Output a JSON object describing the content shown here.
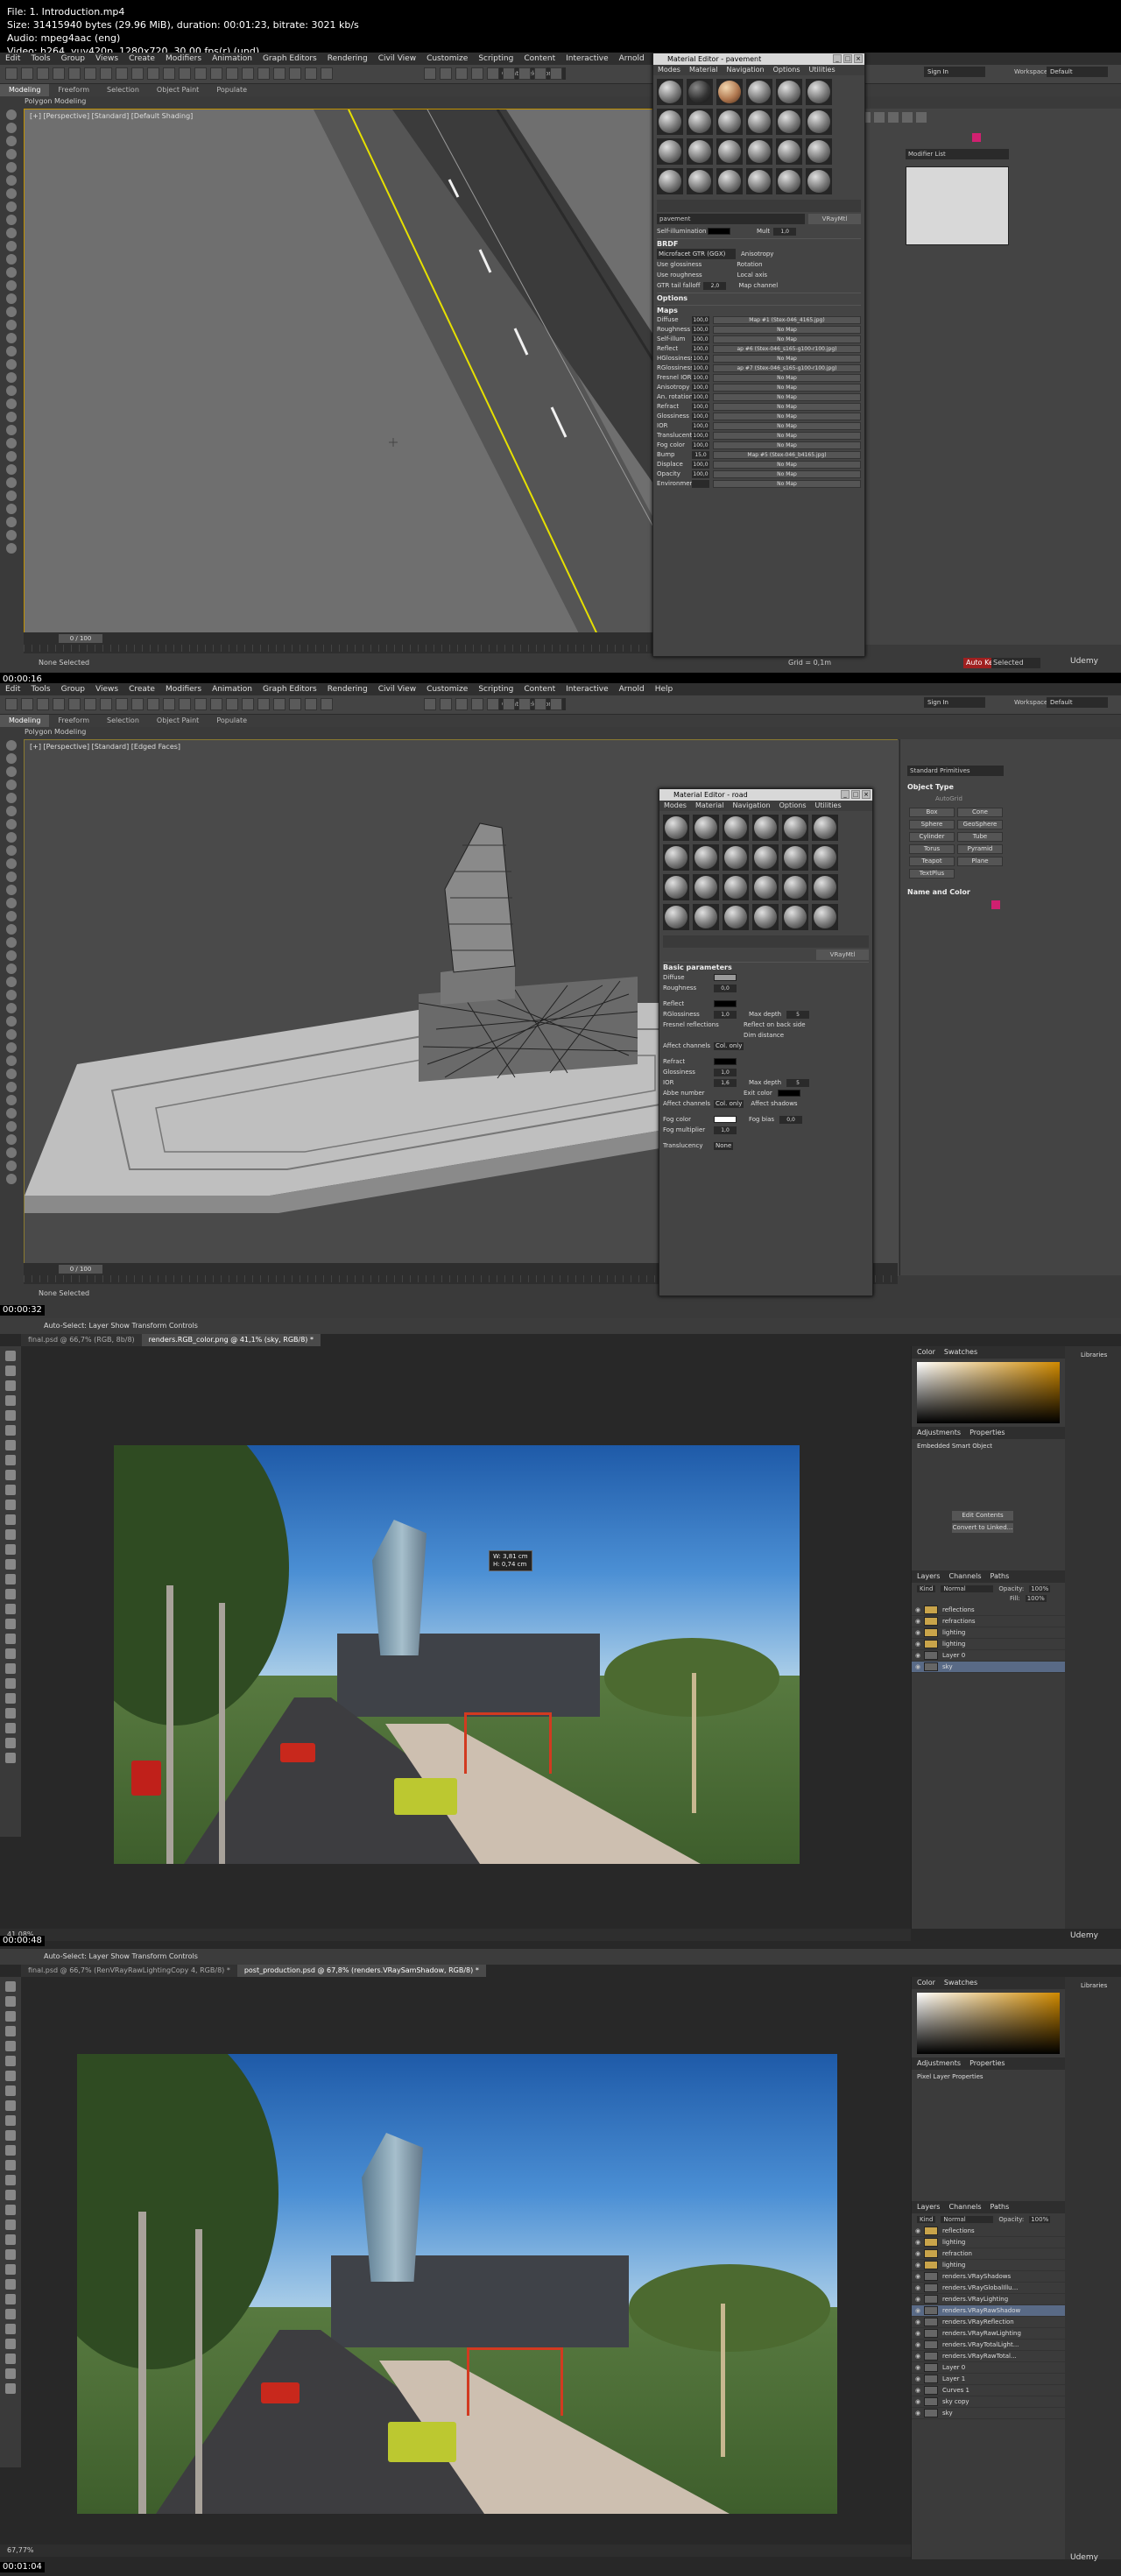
{
  "file_info": {
    "line1": "File: 1. Introduction.mp4",
    "line2": "Size: 31415940 bytes (29.96 MiB), duration: 00:01:23, bitrate: 3021 kb/s",
    "line3": "Audio: mpeg4aac (eng)",
    "line4": "Video: h264, yuv420p, 1280x720, 30.00 fps(r) (und)"
  },
  "max_menu": [
    "Edit",
    "Tools",
    "Group",
    "Views",
    "Create",
    "Modifiers",
    "Animation",
    "Graph Editors",
    "Rendering",
    "Civil View",
    "Customize",
    "Scripting",
    "Content",
    "Interactive",
    "Arnold",
    "Help"
  ],
  "max_ribbon": [
    "Modeling",
    "Freeform",
    "Selection",
    "Object Paint",
    "Populate"
  ],
  "max_signin": "Sign In",
  "max_workspaces_label": "Workspaces:",
  "max_workspaces_value": "Default",
  "max_selection_set": "Create Selection Se",
  "polygon_modeling": "Polygon Modeling",
  "frame1": {
    "timestamp": "00:00:16",
    "vp_label": "[+] [Perspective] [Standard] [Default Shading]",
    "frame_counter": "0 / 100",
    "status_left": "None Selected",
    "grid": "Grid = 0,1m",
    "autokey": "Auto Key",
    "set_key": "Selected",
    "modifier_list": "Modifier List"
  },
  "frame2": {
    "timestamp": "00:00:32",
    "vp_label": "[+] [Perspective] [Standard] [Edged Faces]",
    "frame_counter": "0 / 100",
    "status_left": "None Selected",
    "std_primitives": "Standard Primitives",
    "object_type": "Object Type",
    "autogrid": "AutoGrid",
    "objects": [
      "Box",
      "Cone",
      "Sphere",
      "GeoSphere",
      "Cylinder",
      "Tube",
      "Torus",
      "Pyramid",
      "Teapot",
      "Plane",
      "TextPlus"
    ],
    "name_and_color": "Name and Color"
  },
  "mat1": {
    "title": "Material Editor - pavement",
    "menu": [
      "Modes",
      "Material",
      "Navigation",
      "Options",
      "Utilities"
    ],
    "mat_name": "pavement",
    "mat_type": "VRayMtl",
    "self_illum_label": "Self-illumination",
    "mult_label": "Mult",
    "mult_value": "1,0",
    "brdf_head": "BRDF",
    "brdf_type": "Microfacet GTR (GGX)",
    "use_glossiness": "Use glossiness",
    "use_roughness": "Use roughness",
    "gtr_tail": "GTR tail falloff",
    "gtr_value": "2,0",
    "anisotropy": "Anisotropy",
    "rotation": "Rotation",
    "local_axis": "Local axis",
    "map_channel": "Map channel",
    "options_head": "Options",
    "maps_head": "Maps",
    "maps": [
      {
        "name": "Diffuse",
        "val": "100,0",
        "map": "Map #1 (Stex-046_4165.jpg)"
      },
      {
        "name": "Roughness",
        "val": "100,0",
        "map": "No Map"
      },
      {
        "name": "Self-illum",
        "val": "100,0",
        "map": "No Map"
      },
      {
        "name": "Reflect",
        "val": "100,0",
        "map": "ap #6 (Stex-046_s165-g100-r100.jpg)"
      },
      {
        "name": "HGlossiness",
        "val": "100,0",
        "map": "No Map"
      },
      {
        "name": "RGlossiness",
        "val": "100,0",
        "map": "ap #7 (Stex-046_s165-g100-r100.jpg)"
      },
      {
        "name": "Fresnel IOR",
        "val": "100,0",
        "map": "No Map"
      },
      {
        "name": "Anisotropy",
        "val": "100,0",
        "map": "No Map"
      },
      {
        "name": "An. rotation",
        "val": "100,0",
        "map": "No Map"
      },
      {
        "name": "Refract",
        "val": "100,0",
        "map": "No Map"
      },
      {
        "name": "Glossiness",
        "val": "100,0",
        "map": "No Map"
      },
      {
        "name": "IOR",
        "val": "100,0",
        "map": "No Map"
      },
      {
        "name": "Translucent",
        "val": "100,0",
        "map": "No Map"
      },
      {
        "name": "Fog color",
        "val": "100,0",
        "map": "No Map"
      },
      {
        "name": "Bump",
        "val": "15,0",
        "map": "Map #5 (Stex-046_b4165.jpg)"
      },
      {
        "name": "Displace",
        "val": "100,0",
        "map": "No Map"
      },
      {
        "name": "Opacity",
        "val": "100,0",
        "map": "No Map"
      },
      {
        "name": "Environment",
        "val": "",
        "map": "No Map"
      }
    ]
  },
  "mat2": {
    "title": "Material Editor - road",
    "menu": [
      "Modes",
      "Material",
      "Navigation",
      "Options",
      "Utilities"
    ],
    "mat_type": "VRayMtl",
    "basic_head": "Basic parameters",
    "diffuse": "Diffuse",
    "roughness": "Roughness",
    "roughness_val": "0,0",
    "reflect": "Reflect",
    "rglossiness": "RGlossiness",
    "rglossiness_val": "1,0",
    "max_depth": "Max depth",
    "max_depth_val": "5",
    "fresnel": "Fresnel reflections",
    "reflect_back": "Reflect on back side",
    "dim_distance": "Dim distance",
    "affect_channels": "Affect channels",
    "color_only": "Col. only",
    "refract": "Refract",
    "glossiness": "Glossiness",
    "glossiness_val": "1,0",
    "ior": "IOR",
    "ior_val": "1,6",
    "refract_depth": "5",
    "abbe": "Abbe number",
    "exit_color": "Exit color",
    "affect_shadows": "Affect shadows",
    "fog_color": "Fog color",
    "fog_bias": "Fog bias",
    "fog_bias_val": "0,0",
    "fog_mult": "Fog multiplier",
    "fog_mult_val": "1,0",
    "translucency": "Translucency",
    "translucency_val": "None"
  },
  "ps_options": "Auto-Select:   Layer     Show Transform Controls",
  "frame3": {
    "timestamp": "00:00:48",
    "tabs": [
      "final.psd @ 66,7% (RGB, 8b/8)",
      "renders.RGB_color.png @ 41,1% (sky, RGB/8) *"
    ],
    "status": "41,08%",
    "measure_w": "W: 3,81 cm",
    "measure_h": "H: 0,74 cm",
    "properties_title": "Embedded Smart Object",
    "edit_contents": "Edit Contents",
    "convert_linked": "Convert to Linked...",
    "layers": [
      {
        "name": "reflections",
        "folder": true
      },
      {
        "name": "refractions",
        "folder": true
      },
      {
        "name": "lighting",
        "folder": true
      },
      {
        "name": "lighting",
        "folder": true
      },
      {
        "name": "Layer 0",
        "folder": false
      },
      {
        "name": "sky",
        "folder": false,
        "selected": true
      }
    ]
  },
  "frame4": {
    "timestamp": "00:01:04",
    "tabs": [
      "final.psd @ 66,7% (RenVRayRawLightingCopy 4, RGB/8) *",
      "post_production.psd @ 67,8% (renders.VRaySamShadow, RGB/8) *"
    ],
    "status": "67,77%",
    "properties_title": "Pixel Layer Properties",
    "layers": [
      {
        "name": "reflections",
        "folder": true
      },
      {
        "name": "lighting",
        "folder": true
      },
      {
        "name": "refraction",
        "folder": true
      },
      {
        "name": "lighting",
        "folder": true
      },
      {
        "name": "renders.VRayShadows",
        "folder": false
      },
      {
        "name": "renders.VRayGlobalIllu...",
        "folder": false
      },
      {
        "name": "renders.VRayLighting",
        "folder": false
      },
      {
        "name": "renders.VRayRawShadow",
        "folder": false,
        "selected": true
      },
      {
        "name": "renders.VRayReflection",
        "folder": false
      },
      {
        "name": "renders.VRayRawLighting",
        "folder": false
      },
      {
        "name": "renders.VRayTotalLight...",
        "folder": false
      },
      {
        "name": "renders.VRayRawTotal...",
        "folder": false
      },
      {
        "name": "Layer 0",
        "folder": false
      },
      {
        "name": "Layer 1",
        "folder": false
      },
      {
        "name": "Curves 1",
        "folder": false
      },
      {
        "name": "sky copy",
        "folder": false
      },
      {
        "name": "sky",
        "folder": false
      }
    ]
  },
  "ps_panels": {
    "color": "Color",
    "swatches": "Swatches",
    "adjustments": "Adjustments",
    "properties": "Properties",
    "layers": "Layers",
    "channels": "Channels",
    "paths": "Paths",
    "libraries": "Libraries",
    "kind": "Kind",
    "blend": "Normal",
    "opacity": "Opacity:",
    "opacity_val": "100%",
    "fill": "Fill:",
    "fill_val": "100%"
  },
  "udemy": "Udemy",
  "colors": {
    "accent_yellow": "#c09000",
    "ps_selection": "#596a86",
    "shelter_red": "#d23a20"
  }
}
